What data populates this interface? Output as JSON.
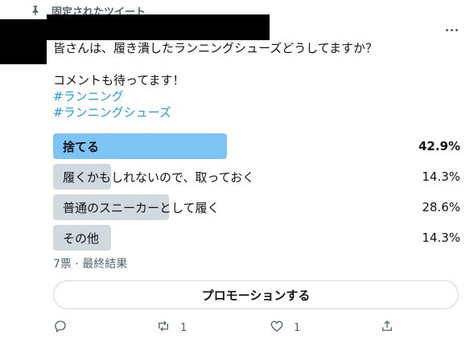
{
  "pinned": {
    "label": "固定されたツイート",
    "icon": "pin-icon"
  },
  "tweet": {
    "lines": [
      "皆さんは、履き潰したランニングシューズどうしてますか？",
      "コメントも待ってます！"
    ],
    "hashtags": [
      "#ランニング",
      "#ランニングシューズ"
    ]
  },
  "poll": {
    "options": [
      {
        "label": "捨てる",
        "percent_text": "42.9%",
        "percent": 42.9,
        "winner": true
      },
      {
        "label": "履くかもしれないので、取っておく",
        "percent_text": "14.3%",
        "percent": 14.3,
        "winner": false
      },
      {
        "label": "普通のスニーカーとして履く",
        "percent_text": "28.6%",
        "percent": 28.6,
        "winner": false
      },
      {
        "label": "その他",
        "percent_text": "14.3%",
        "percent": 14.3,
        "winner": false
      }
    ],
    "meta": "7票 · 最終結果"
  },
  "promote": {
    "label": "プロモーションする"
  },
  "actions": {
    "reply_count": "",
    "retweet_count": "1",
    "like_count": "1"
  },
  "colors": {
    "winner_bar": "#7dc4f4",
    "bar": "#cfd9de",
    "link": "#1d9bf0",
    "muted": "#536471"
  }
}
